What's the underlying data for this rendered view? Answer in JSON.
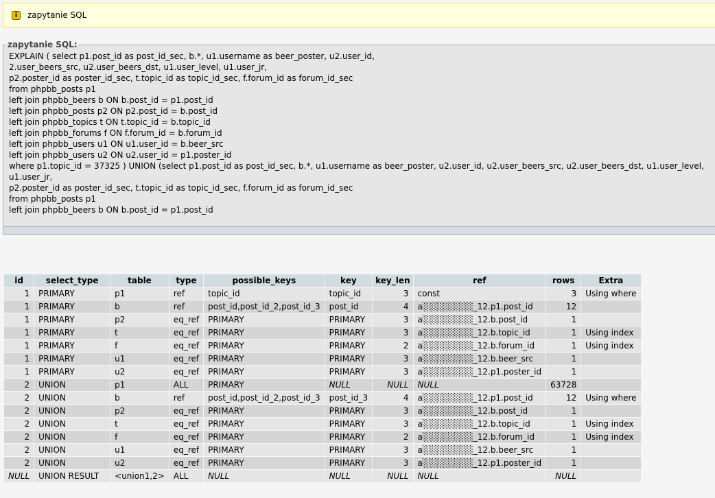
{
  "notice": {
    "text": "zapytanie SQL",
    "icon": "info-icon"
  },
  "sql_box": {
    "legend": "zapytanie SQL:",
    "lines": [
      "EXPLAIN ( select p1.post_id as post_id_sec, b.*, u1.username as beer_poster, u2.user_id,",
      "2.user_beers_src, u2.user_beers_dst, u1.user_level, u1.user_jr,",
      "p2.poster_id as poster_id_sec, t.topic_id as topic_id_sec, f.forum_id as forum_id_sec",
      "from phpbb_posts p1",
      "left join phpbb_beers b ON b.post_id = p1.post_id",
      "left join phpbb_posts p2 ON p2.post_id = b.post_id",
      "left join phpbb_topics t ON t.topic_id = b.topic_id",
      "left join phpbb_forums f ON f.forum_id = b.forum_id",
      "left join phpbb_users u1 ON u1.user_id = b.beer_src",
      "left join phpbb_users u2 ON u2.user_id = p1.poster_id",
      "where p1.topic_id = 37325 ) UNION (select p1.post_id as post_id_sec, b.*, u1.username as beer_poster, u2.user_id, u2.user_beers_src, u2.user_beers_dst, u1.user_level,",
      "u1.user_jr,",
      "p2.poster_id as poster_id_sec, t.topic_id as topic_id_sec, f.forum_id as forum_id_sec",
      "from phpbb_posts p1",
      "left join phpbb_beers b ON b.post_id = p1.post_id"
    ]
  },
  "table": {
    "headers": [
      "id",
      "select_type",
      "table",
      "type",
      "possible_keys",
      "key",
      "key_len",
      "ref",
      "rows",
      "Extra"
    ],
    "rows": [
      [
        "1",
        "PRIMARY",
        "p1",
        "ref",
        "topic_id",
        "topic_id",
        "3",
        "const",
        "3",
        "Using where"
      ],
      [
        "1",
        "PRIMARY",
        "b",
        "ref",
        "post_id,post_id_2,post_id_3",
        "post_id",
        "4",
        "a░░░░░░░░_12.p1.post_id",
        "12",
        ""
      ],
      [
        "1",
        "PRIMARY",
        "p2",
        "eq_ref",
        "PRIMARY",
        "PRIMARY",
        "3",
        "a░░░░░░░░_12.b.post_id",
        "1",
        ""
      ],
      [
        "1",
        "PRIMARY",
        "t",
        "eq_ref",
        "PRIMARY",
        "PRIMARY",
        "3",
        "a░░░░░░░░_12.b.topic_id",
        "1",
        "Using index"
      ],
      [
        "1",
        "PRIMARY",
        "f",
        "eq_ref",
        "PRIMARY",
        "PRIMARY",
        "2",
        "a░░░░░░░░_12.b.forum_id",
        "1",
        "Using index"
      ],
      [
        "1",
        "PRIMARY",
        "u1",
        "eq_ref",
        "PRIMARY",
        "PRIMARY",
        "3",
        "a░░░░░░░░_12.b.beer_src",
        "1",
        ""
      ],
      [
        "1",
        "PRIMARY",
        "u2",
        "eq_ref",
        "PRIMARY",
        "PRIMARY",
        "3",
        "a░░░░░░░░_12.p1.poster_id",
        "1",
        ""
      ],
      [
        "2",
        "UNION",
        "p1",
        "ALL",
        "PRIMARY",
        "NULL",
        "NULL",
        "NULL",
        "63728",
        ""
      ],
      [
        "2",
        "UNION",
        "b",
        "ref",
        "post_id,post_id_2,post_id_3",
        "post_id_3",
        "4",
        "a░░░░░░░░_12.p1.post_id",
        "12",
        "Using where"
      ],
      [
        "2",
        "UNION",
        "p2",
        "eq_ref",
        "PRIMARY",
        "PRIMARY",
        "3",
        "a░░░░░░░░_12.b.post_id",
        "1",
        ""
      ],
      [
        "2",
        "UNION",
        "t",
        "eq_ref",
        "PRIMARY",
        "PRIMARY",
        "3",
        "a░░░░░░░░_12.b.topic_id",
        "1",
        "Using index"
      ],
      [
        "2",
        "UNION",
        "f",
        "eq_ref",
        "PRIMARY",
        "PRIMARY",
        "2",
        "a░░░░░░░░_12.b.forum_id",
        "1",
        "Using index"
      ],
      [
        "2",
        "UNION",
        "u1",
        "eq_ref",
        "PRIMARY",
        "PRIMARY",
        "3",
        "a░░░░░░░░_12.b.beer_src",
        "1",
        ""
      ],
      [
        "2",
        "UNION",
        "u2",
        "eq_ref",
        "PRIMARY",
        "PRIMARY",
        "3",
        "a░░░░░░░░_12.p1.poster_id",
        "1",
        ""
      ],
      [
        "NULL",
        "UNION RESULT",
        "<union1,2>",
        "ALL",
        "NULL",
        "NULL",
        "NULL",
        "NULL",
        "NULL",
        ""
      ]
    ]
  },
  "colors": {
    "notice_bg": "#ffffdd",
    "header_bg": "#d0dce0",
    "row_odd": "#e5e5e5",
    "row_even": "#d5d5d5"
  }
}
